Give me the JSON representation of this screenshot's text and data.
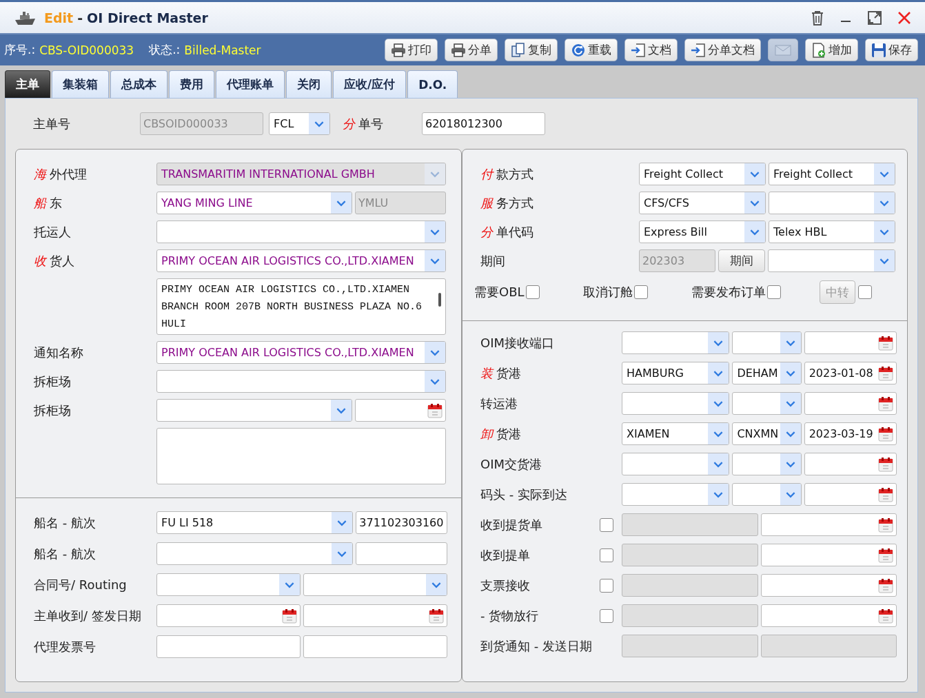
{
  "window": {
    "mode": "Edit",
    "separator": "-",
    "title": "OI Direct Master"
  },
  "info_bar": {
    "serial_label": "序号.:",
    "serial": "CBS-OID000033",
    "status_label": "状态.:",
    "status": "Billed-Master"
  },
  "toolbar": [
    {
      "label": "打印",
      "disabled": false
    },
    {
      "label": "分单",
      "disabled": false
    },
    {
      "label": "复制",
      "disabled": false
    },
    {
      "label": "重载",
      "disabled": false
    },
    {
      "label": "文档",
      "disabled": false
    },
    {
      "label": "分单文档",
      "disabled": false
    },
    {
      "disabled": true
    },
    {
      "label": "增加",
      "disabled": false
    },
    {
      "label": "保存",
      "disabled": false
    }
  ],
  "tabs": [
    {
      "label": "主单",
      "selected": true
    },
    {
      "label": "集装箱",
      "selected": false
    },
    {
      "label": "总成本",
      "selected": false
    },
    {
      "label": "费用",
      "selected": false
    },
    {
      "label": "代理账单",
      "selected": false
    },
    {
      "label": "关闭",
      "selected": false
    },
    {
      "label": "应收/应付",
      "selected": false
    },
    {
      "label": "D.O.",
      "selected": false
    }
  ],
  "master": {
    "label": "主单号",
    "number": "CBSOID000033",
    "load_type": "FCL",
    "house_flag": "分",
    "house_label": "单号",
    "house_number": "62018012300"
  },
  "left_top": [
    {
      "flag": "海",
      "label": "外代理",
      "controls": [
        {
          "kind": "locked-party-select",
          "value": "TRANSMARITIM INTERNATIONAL GMBH"
        }
      ]
    },
    {
      "flag": "船",
      "label": "东",
      "controls": [
        {
          "kind": "party-select",
          "value": "YANG MING LINE"
        },
        {
          "kind": "readonly",
          "value": "YMLU"
        }
      ]
    },
    {
      "label": "托运人",
      "controls": [
        {
          "kind": "select"
        }
      ]
    },
    {
      "flag": "收",
      "label": "货人",
      "controls": [
        {
          "kind": "party-select",
          "value": "PRIMY OCEAN AIR LOGISTICS CO.,LTD.XIAMEN"
        }
      ]
    },
    {
      "controls": [
        {
          "kind": "textarea",
          "value": "PRIMY OCEAN AIR LOGISTICS CO.,LTD.XIAMEN BRANCH ROOM 207B NORTH BUSINESS PLAZA NO.6 HULI"
        }
      ]
    },
    {
      "label": "通知名称",
      "controls": [
        {
          "kind": "party-select",
          "value": "PRIMY OCEAN AIR LOGISTICS CO.,LTD.XIAMEN"
        }
      ]
    },
    {
      "label": "拆柜场",
      "controls": [
        {
          "kind": "select"
        }
      ]
    },
    {
      "label": "拆柜场",
      "controls": [
        {
          "kind": "select"
        },
        {
          "kind": "date"
        }
      ]
    },
    {
      "controls": [
        {
          "kind": "memo"
        }
      ]
    }
  ],
  "left_bottom": [
    {
      "label": "船名 - 航次",
      "controls": [
        {
          "kind": "select",
          "value": "FU LI 518"
        },
        {
          "kind": "text",
          "value": "371102303160"
        }
      ]
    },
    {
      "label": "船名 - 航次",
      "controls": [
        {
          "kind": "select"
        },
        {
          "kind": "text"
        }
      ]
    },
    {
      "label": "合同号/ Routing",
      "controls": [
        {
          "kind": "select"
        },
        {
          "kind": "select"
        }
      ]
    },
    {
      "label": "主单收到/ 签发日期",
      "controls": [
        {
          "kind": "date"
        },
        {
          "kind": "date"
        }
      ]
    },
    {
      "label": "代理发票号",
      "controls": [
        {
          "kind": "text"
        },
        {
          "kind": "text"
        }
      ]
    }
  ],
  "right_top": [
    {
      "flag": "付",
      "label": "款方式",
      "controls": [
        {
          "kind": "select",
          "value": "Freight Collect"
        },
        {
          "kind": "select",
          "value": "Freight Collect"
        }
      ]
    },
    {
      "flag": "服",
      "label": "务方式",
      "controls": [
        {
          "kind": "select",
          "value": "CFS/CFS"
        },
        {
          "kind": "select"
        }
      ]
    },
    {
      "flag": "分",
      "label": "单代码",
      "controls": [
        {
          "kind": "select",
          "value": "Express Bill"
        },
        {
          "kind": "select",
          "value": "Telex HBL"
        }
      ]
    },
    {
      "label": "期间",
      "controls": [
        {
          "kind": "readonly",
          "value": "202303"
        },
        {
          "kind": "button",
          "value": "期间"
        },
        {
          "kind": "select"
        }
      ]
    }
  ],
  "options": [
    {
      "kind": "check",
      "label": "需要OBL",
      "checked": false
    },
    {
      "kind": "check",
      "label": "取消订舱",
      "checked": false
    },
    {
      "kind": "check",
      "label": "需要发布订单",
      "checked": false
    },
    {
      "kind": "button-check",
      "label": "中转",
      "checked": false
    }
  ],
  "right_bottom": [
    {
      "label": "OIM接收端口",
      "controls": [
        {
          "kind": "select"
        },
        {
          "kind": "select"
        },
        {
          "kind": "date"
        }
      ]
    },
    {
      "flag": "装",
      "label": "货港",
      "controls": [
        {
          "kind": "select",
          "value": "HAMBURG"
        },
        {
          "kind": "select",
          "value": "DEHAM"
        },
        {
          "kind": "date",
          "value": "2023-01-08"
        }
      ]
    },
    {
      "label": "转运港",
      "controls": [
        {
          "kind": "select"
        },
        {
          "kind": "select"
        },
        {
          "kind": "date"
        }
      ]
    },
    {
      "flag": "卸",
      "label": "货港",
      "controls": [
        {
          "kind": "select",
          "value": "XIAMEN"
        },
        {
          "kind": "select",
          "value": "CNXMN"
        },
        {
          "kind": "date",
          "value": "2023-03-19"
        }
      ]
    },
    {
      "label": "OIM交货港",
      "controls": [
        {
          "kind": "select"
        },
        {
          "kind": "select"
        },
        {
          "kind": "date"
        }
      ]
    },
    {
      "label": "码头 - 实际到达",
      "controls": [
        {
          "kind": "select"
        },
        {
          "kind": "select"
        },
        {
          "kind": "date"
        }
      ]
    },
    {
      "label": "收到提货单",
      "checked": false,
      "controls": [
        {
          "kind": "readonly"
        },
        {
          "kind": "date"
        }
      ]
    },
    {
      "label": "收到提单",
      "checked": false,
      "controls": [
        {
          "kind": "readonly"
        },
        {
          "kind": "date"
        }
      ]
    },
    {
      "label": "支票接收",
      "checked": false,
      "controls": [
        {
          "kind": "readonly"
        },
        {
          "kind": "date"
        }
      ]
    },
    {
      "label": "- 货物放行",
      "checked": false,
      "controls": [
        {
          "kind": "readonly"
        },
        {
          "kind": "date"
        }
      ]
    },
    {
      "label": "到货通知 - 发送日期",
      "controls": [
        {
          "kind": "readonly"
        },
        {
          "kind": "readonly"
        }
      ]
    }
  ]
}
